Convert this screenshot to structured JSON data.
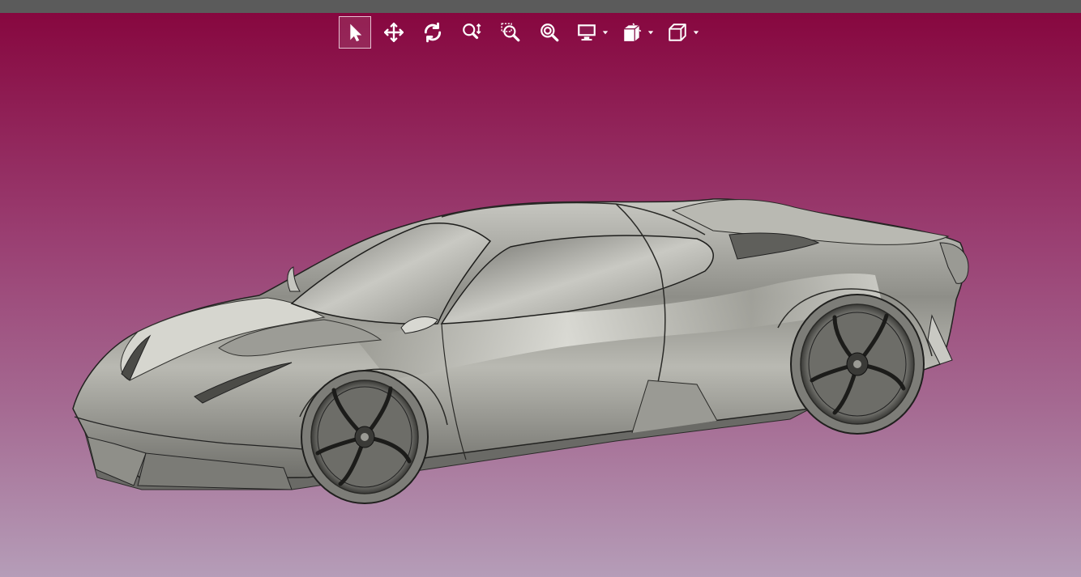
{
  "app": {
    "viewer": "3D model viewer"
  },
  "toolbar": {
    "tools": [
      {
        "id": "select",
        "icon": "cursor-arrow-icon",
        "active": true
      },
      {
        "id": "pan",
        "icon": "move-arrows-icon",
        "active": false
      },
      {
        "id": "rotate",
        "icon": "rotate-icon",
        "active": false
      },
      {
        "id": "zoom",
        "icon": "zoom-updown-icon",
        "active": false
      },
      {
        "id": "zoom-window",
        "icon": "zoom-window-icon",
        "active": false
      },
      {
        "id": "zoom-fit",
        "icon": "zoom-fit-icon",
        "active": false
      },
      {
        "id": "display-mode",
        "icon": "monitor-icon",
        "dropdown": true
      },
      {
        "id": "section-view",
        "icon": "section-plane-icon",
        "dropdown": true
      },
      {
        "id": "view-orientation",
        "icon": "cube-view-icon",
        "dropdown": true
      }
    ]
  },
  "scene": {
    "model": "sports-car",
    "background_top": "#87073f",
    "background_bottom": "#b59db8",
    "model_color": "#a7a79f"
  }
}
